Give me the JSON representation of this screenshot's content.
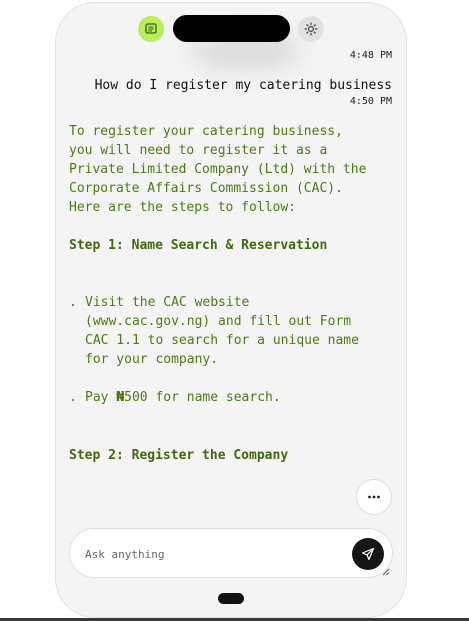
{
  "conversation": {
    "user_time": "4:48 PM",
    "user_message": "How do I register my catering business",
    "reply_time": "4:50 PM",
    "reply_intro": [
      "To register your catering business,",
      "you will need to register it as a",
      "Private Limited Company (Ltd) with the",
      "Corporate Affairs Commission (CAC).",
      "Here are the steps to follow:"
    ],
    "step1_heading": "Step 1: Name Search & Reservation",
    "step1_bullets": [
      {
        "marker": ".",
        "lines": [
          "Visit the CAC website",
          "(www.cac.gov.ng) and fill out Form",
          "CAC 1.1 to search for a unique name",
          "for your company."
        ]
      },
      {
        "marker": ".",
        "pre": "Pay ",
        "currency": "₦",
        "post": "500 for name search."
      }
    ],
    "step2_heading": "Step 2: Register the Company"
  },
  "composer": {
    "placeholder": "Ask anything"
  },
  "icons": {
    "chat": "chat-icon",
    "theme": "sun-icon",
    "more": "ellipsis-icon",
    "send": "send-icon"
  },
  "colors": {
    "accent": "#b7ef5b",
    "answer_text": "#4d7a14",
    "heading_text": "#3e6a0c",
    "send_button": "#161616"
  }
}
